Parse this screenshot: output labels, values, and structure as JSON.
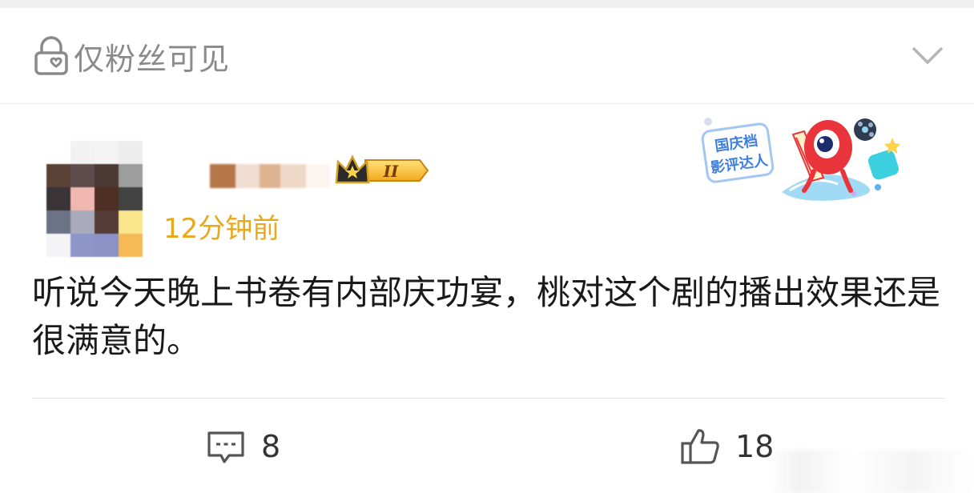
{
  "post": {
    "visibility_label": "仅粉丝可见",
    "timestamp": "12分钟前",
    "content": "听说今天晚上书卷有内部庆功宴，桃对这个剧的播出效果还是很满意的。",
    "badge_level": "II",
    "sticker_text": [
      "国庆档",
      "影评达人"
    ]
  },
  "actions": {
    "comment_count": "8",
    "like_count": "18"
  },
  "colors": {
    "timestamp": "#e8a81b",
    "muted": "#8a8a8a",
    "sticker_red": "#e8343a",
    "sticker_blue": "#3f7fe0"
  },
  "icons": [
    "lock-heart-icon",
    "chevron-down-icon",
    "crown-icon",
    "comment-icon",
    "thumbs-up-icon"
  ]
}
